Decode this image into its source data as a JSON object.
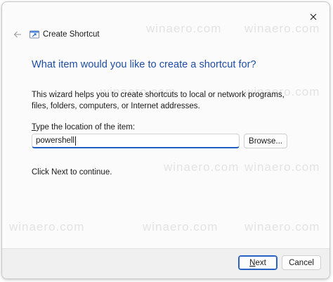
{
  "window": {
    "title": "Create Shortcut",
    "close_icon": "close-icon",
    "back_icon": "back-arrow-icon",
    "app_icon": "shortcut-wizard-icon"
  },
  "main": {
    "heading": "What item would you like to create a shortcut for?",
    "description": "This wizard helps you to create shortcuts to local or network programs, files, folders, computers, or Internet addresses.",
    "field_label_accel": "T",
    "field_label_rest": "ype the location of the item:",
    "location_value": "powershell",
    "browse_label": "Browse...",
    "hint": "Click Next to continue."
  },
  "footer": {
    "next_accel": "N",
    "next_rest": "ext",
    "cancel_label": "Cancel"
  },
  "watermark": {
    "text": "winaero.com"
  },
  "colors": {
    "heading": "#1f4ea1",
    "accent": "#1f5fbf",
    "footer_bg": "#f0f0f0"
  }
}
